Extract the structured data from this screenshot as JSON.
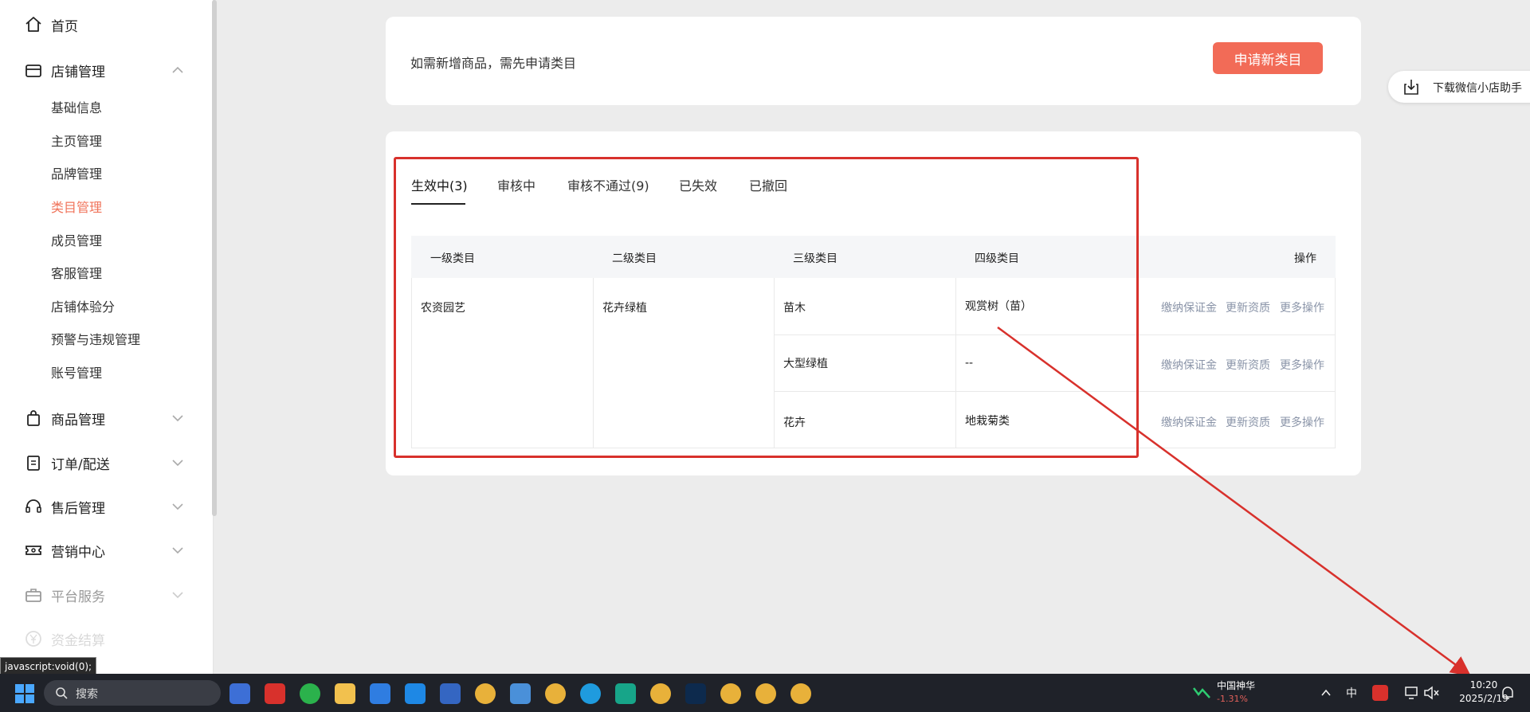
{
  "sidebar": {
    "home": "首页",
    "store_management": "店铺管理",
    "sub_items": [
      "基础信息",
      "主页管理",
      "品牌管理",
      "类目管理",
      "成员管理",
      "客服管理",
      "店铺体验分",
      "预警与违规管理",
      "账号管理"
    ],
    "active_sub": "类目管理",
    "product_management": "商品管理",
    "order_delivery": "订单/配送",
    "after_sales": "售后管理",
    "marketing_center": "营销中心",
    "platform_service": "平台服务",
    "funds": "资金结算"
  },
  "status_bar_url": "javascript:void(0);",
  "notice": {
    "text": "如需新增商品，需先申请类目",
    "apply_button": "申请新类目"
  },
  "download_helper": "下载微信小店助手",
  "tabs": [
    "生效中(3)",
    "审核中",
    "审核不通过(9)",
    "已失效",
    "已撤回"
  ],
  "active_tab": "生效中(3)",
  "table": {
    "headers": [
      "一级类目",
      "二级类目",
      "三级类目",
      "四级类目",
      "操作"
    ],
    "level1": "农资园艺",
    "level2": "花卉绿植",
    "rows": [
      {
        "level3": "苗木",
        "level4": "观赏树（苗）"
      },
      {
        "level3": "大型绿植",
        "level4": "--"
      },
      {
        "level3": "花卉",
        "level4": "地栽菊类"
      }
    ],
    "actions": [
      "缴纳保证金",
      "更新资质",
      "更多操作"
    ]
  },
  "taskbar": {
    "search_label": "搜索",
    "stock_name": "中国神华",
    "stock_change": "-1.31%",
    "ime": "中",
    "time": "10:20",
    "date": "2025/2/19"
  },
  "colors": {
    "accent": "#f26b57",
    "active_nav": "#f0735a",
    "annotation_red": "#d8312c",
    "link_gray": "#8a94a8"
  }
}
